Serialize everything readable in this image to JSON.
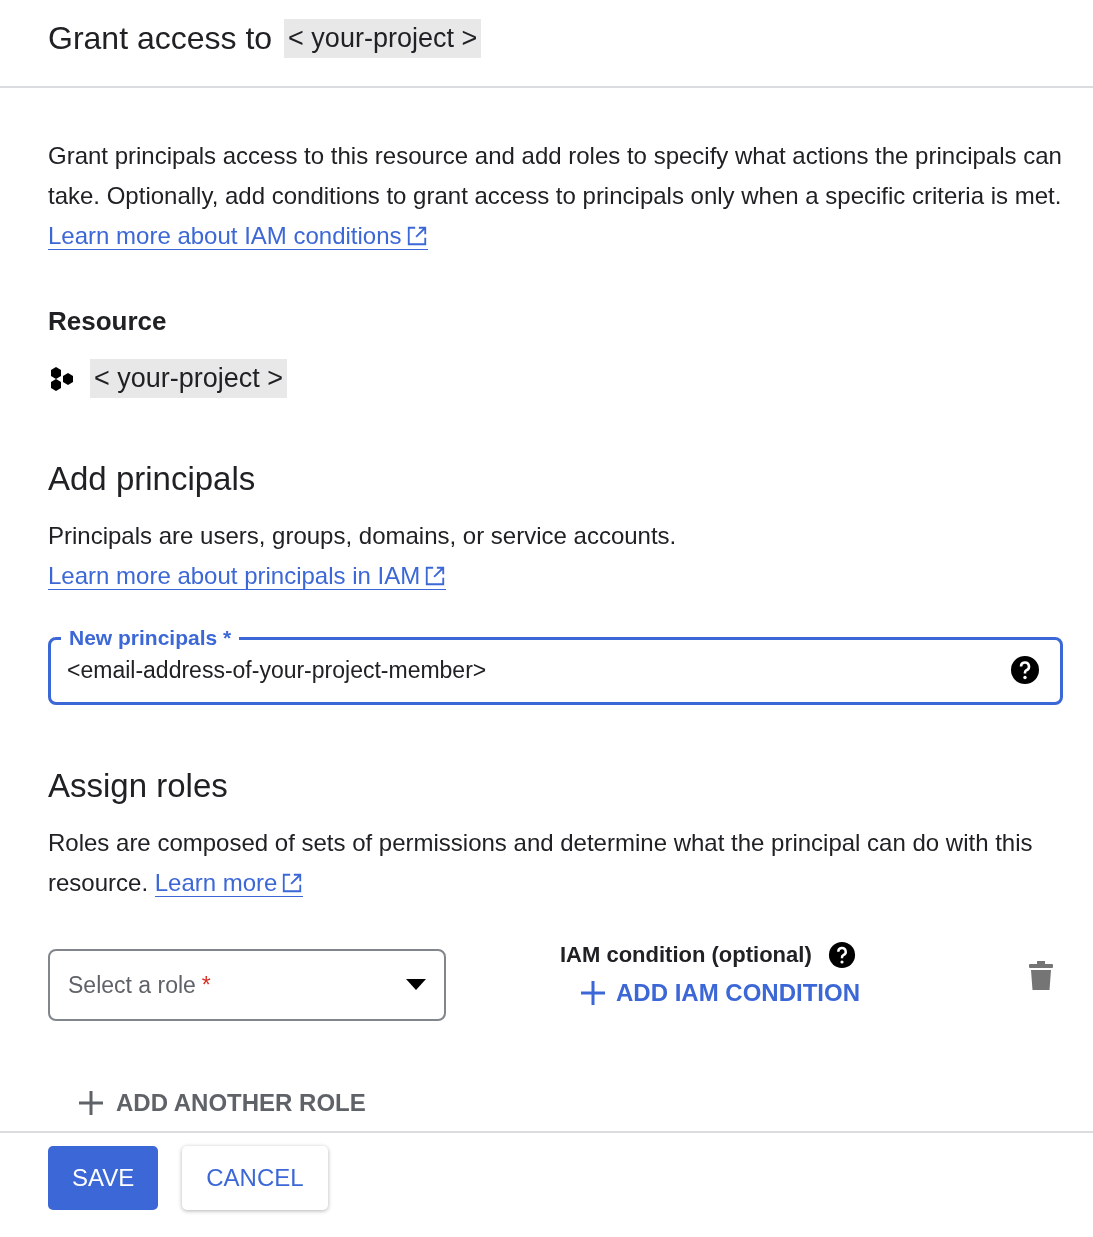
{
  "header": {
    "title": "Grant access to",
    "project": "< your-project >"
  },
  "intro": {
    "text": "Grant principals access to this resource and add roles to specify what actions the principals can take. Optionally, add conditions to grant access to principals only when a specific criteria is met.",
    "link": "Learn more about IAM conditions"
  },
  "resource": {
    "heading": "Resource",
    "name": "< your-project >"
  },
  "add_principals": {
    "heading": "Add principals",
    "text": "Principals are users, groups, domains, or service accounts.",
    "link": "Learn more about principals in IAM",
    "field": {
      "label": "New principals *",
      "value": "<email-address-of-your-project-member>",
      "focused": true
    }
  },
  "assign_roles": {
    "heading": "Assign roles",
    "text": "Roles are composed of sets of permissions and determine what the principal can do with this resource.",
    "link": "Learn more",
    "role_select": {
      "placeholder": "Select a role",
      "required_mark": "*"
    },
    "condition_label": "IAM condition (optional)",
    "add_condition": "ADD IAM CONDITION",
    "add_another": "ADD ANOTHER ROLE"
  },
  "buttons": [
    {
      "label": "SAVE",
      "kind": "primary"
    },
    {
      "label": "CANCEL",
      "kind": "secondary"
    }
  ]
}
